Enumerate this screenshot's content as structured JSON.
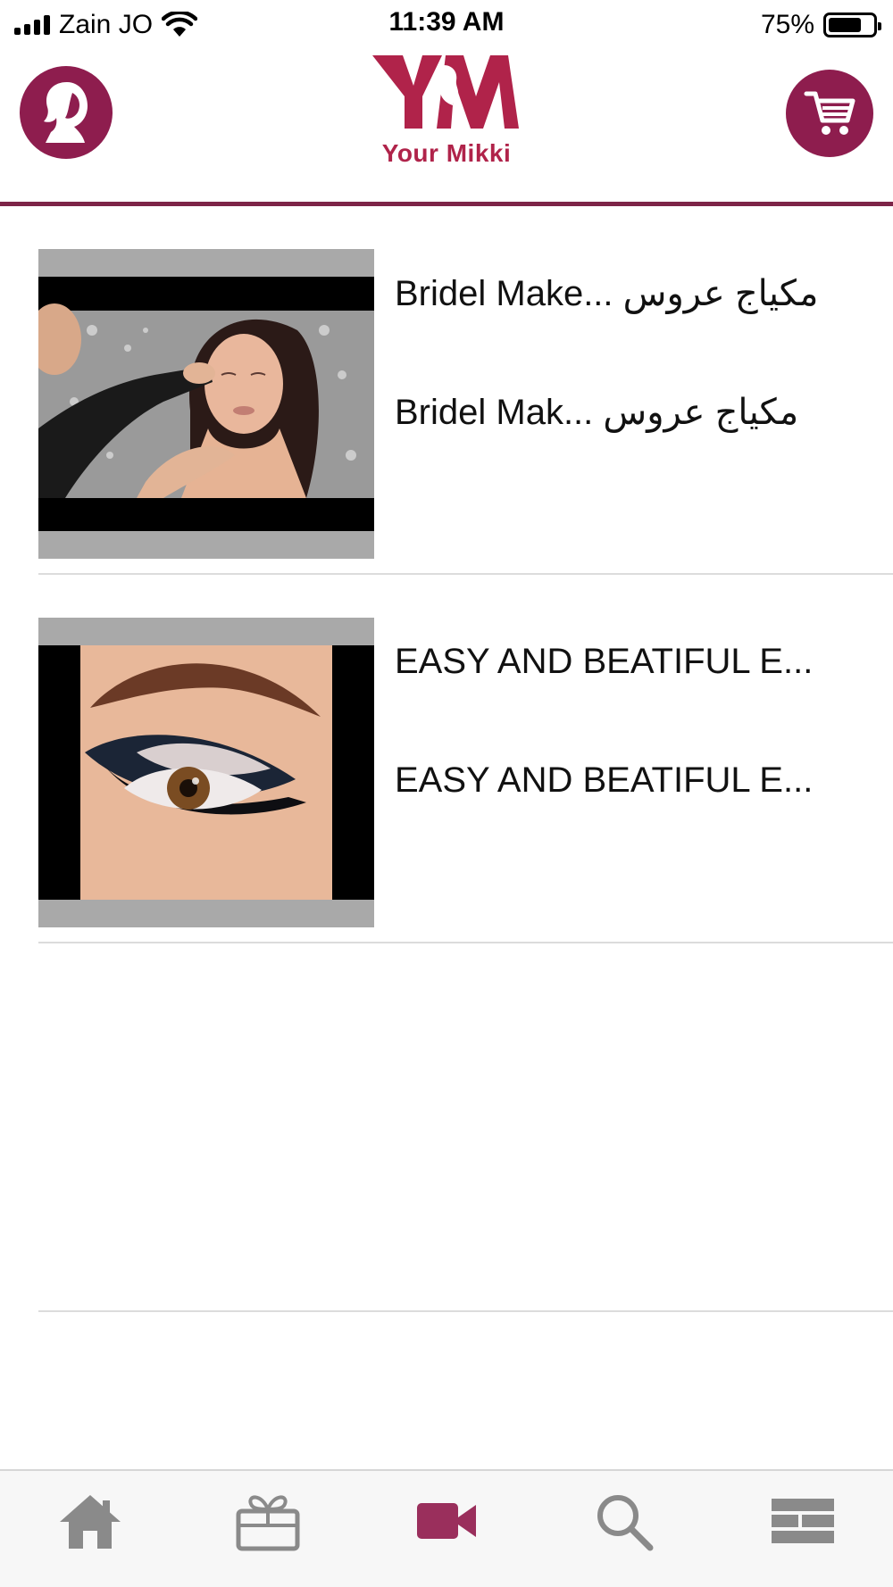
{
  "status_bar": {
    "carrier": "Zain JO",
    "time": "11:39 AM",
    "battery_percent_label": "75%",
    "battery_level": 0.75,
    "signal_bars": 4
  },
  "header": {
    "logo_mark": "YM",
    "logo_text": "Your Mikki",
    "profile_icon": "woman-silhouette-icon",
    "cart_icon": "cart-icon"
  },
  "colors": {
    "brand": "#8e1d4e",
    "logo": "#b0234a",
    "divider": "#7d2448",
    "active_tab": "#9a2f5c",
    "inactive_tab": "#8a8a8a"
  },
  "videos": [
    {
      "title": "Bridel Make... مكياج عروس",
      "subtitle": "Bridel Mak... مكياج عروس",
      "thumbnail": "bridal-makeup-application"
    },
    {
      "title": "EASY AND BEATIFUL E...",
      "subtitle": "EASY AND BEATIFUL E...",
      "thumbnail": "smokey-eye-closeup"
    },
    {
      "title": "",
      "subtitle": "",
      "thumbnail": ""
    }
  ],
  "tabs": [
    {
      "icon": "home-icon",
      "active": false
    },
    {
      "icon": "gift-icon",
      "active": false
    },
    {
      "icon": "video-camera-icon",
      "active": true
    },
    {
      "icon": "search-icon",
      "active": false
    },
    {
      "icon": "grid-menu-icon",
      "active": false
    }
  ]
}
